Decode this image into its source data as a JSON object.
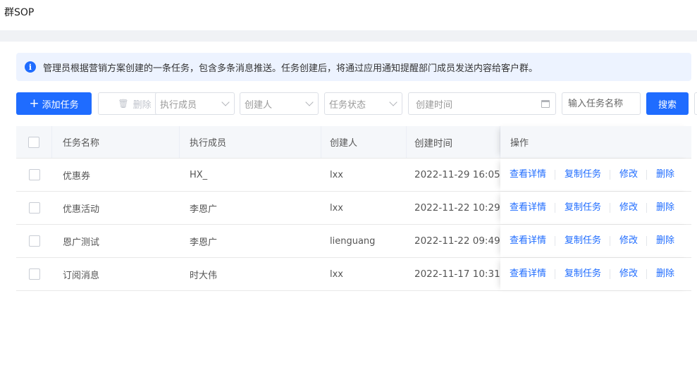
{
  "page": {
    "title": "群SOP"
  },
  "notice": {
    "text": "管理员根据营销方案创建的一条任务，包含多条消息推送。任务创建后，将通过应用通知提醒部门成员发送内容给客户群。"
  },
  "toolbar": {
    "add_label": "添加任务",
    "delete_label": "删除",
    "member_placeholder": "执行成员",
    "creator_placeholder": "创建人",
    "status_placeholder": "任务状态",
    "time_placeholder": "创建时间",
    "name_placeholder": "输入任务名称",
    "search_label": "搜索"
  },
  "table": {
    "headers": [
      "任务名称",
      "执行成员",
      "创建人",
      "创建时间",
      "操作"
    ],
    "ops": [
      "查看详情",
      "复制任务",
      "修改",
      "删除"
    ],
    "rows": [
      {
        "name": "优惠券",
        "member": "HX_",
        "creator": "lxx",
        "time": "2022-11-29 16:05"
      },
      {
        "name": "优惠活动",
        "member": "李恩广",
        "creator": "lxx",
        "time": "2022-11-22 10:29"
      },
      {
        "name": "恩广测试",
        "member": "李恩广",
        "creator": "lienguang",
        "time": "2022-11-22 09:49"
      },
      {
        "name": "订阅消息",
        "member": "时大伟",
        "creator": "lxx",
        "time": "2022-11-17 10:31"
      }
    ]
  },
  "colors": {
    "primary": "#1f6cff",
    "notice_bg": "#edf3ff",
    "header_bg": "#f5f7fa"
  }
}
